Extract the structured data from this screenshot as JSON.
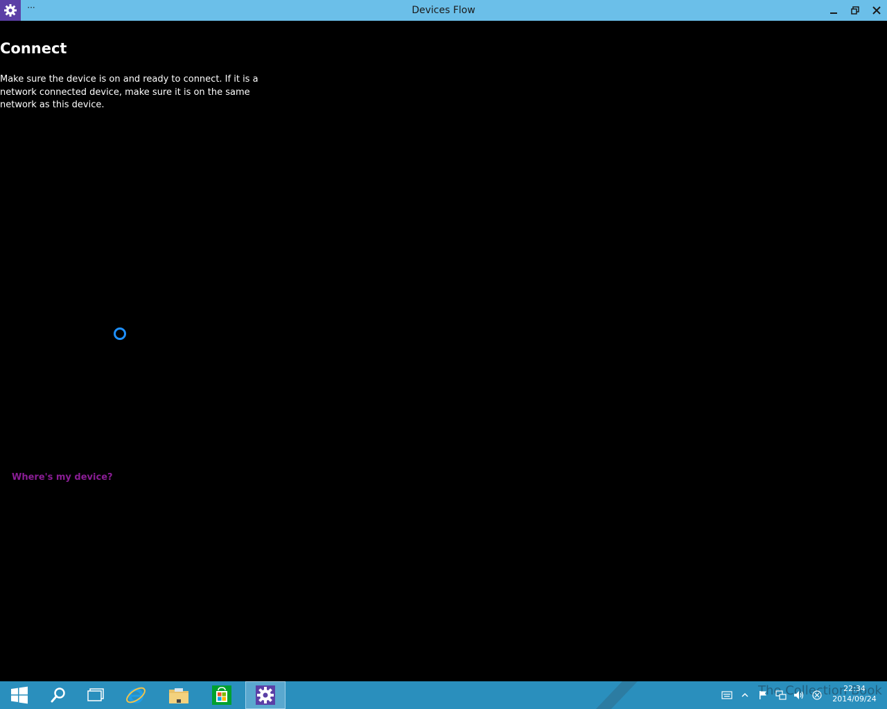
{
  "window": {
    "title": "Devices Flow",
    "menu_label": "···",
    "icons": {
      "app": "gear-icon",
      "minimize": "minimize-icon",
      "restore": "restore-icon",
      "close": "close-icon"
    }
  },
  "main": {
    "heading": "Connect",
    "description": "Make sure the device is on and ready to connect. If it is a network connected device, make sure it is on the same network as this device.",
    "link": "Where's my device?"
  },
  "taskbar": {
    "items": [
      {
        "name": "start",
        "icon": "windows-logo-icon"
      },
      {
        "name": "search",
        "icon": "search-icon"
      },
      {
        "name": "task-view",
        "icon": "task-view-icon"
      },
      {
        "name": "internet-explorer",
        "icon": "ie-icon"
      },
      {
        "name": "file-explorer",
        "icon": "folder-icon"
      },
      {
        "name": "store",
        "icon": "store-icon"
      },
      {
        "name": "settings",
        "icon": "gear-icon"
      }
    ],
    "watermark": "The Collection Book",
    "tray": [
      "keyboard-icon",
      "chevron-up-icon",
      "flag-icon",
      "network-icon",
      "volume-icon",
      "action-center-icon"
    ],
    "clock": {
      "time": "22:34",
      "date": "2014/09/24"
    }
  },
  "colors": {
    "titlebar": "#6bbfe9",
    "background": "#000000",
    "link": "#8a1d95",
    "spinner": "#1e90ff",
    "taskbar": "#2a8fbd",
    "app_icon_bg": "#5b3fa6"
  }
}
